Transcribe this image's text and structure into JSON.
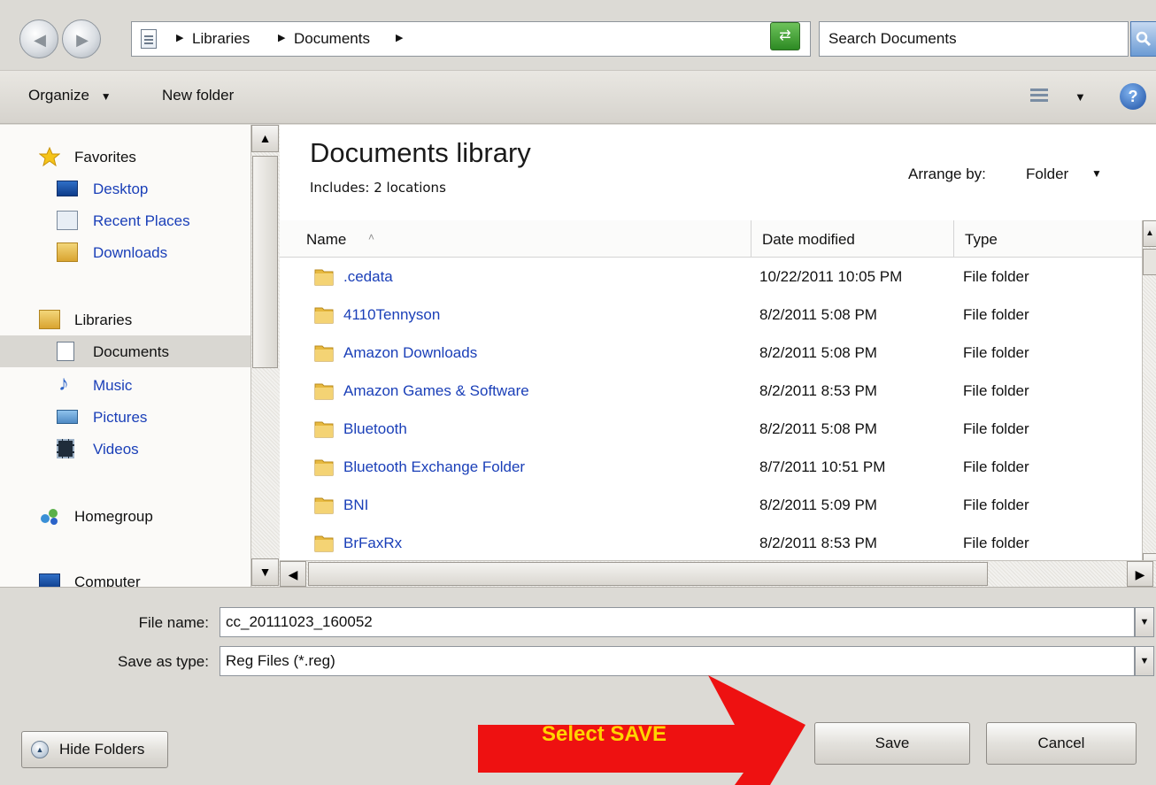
{
  "address_bar": {
    "crumbs": [
      "Libraries",
      "Documents"
    ],
    "search_placeholder": "Search Documents"
  },
  "toolbar": {
    "organize": "Organize",
    "new_folder": "New folder"
  },
  "nav": {
    "favorites": "Favorites",
    "desktop": "Desktop",
    "recent_places": "Recent Places",
    "downloads": "Downloads",
    "libraries": "Libraries",
    "documents": "Documents",
    "music": "Music",
    "pictures": "Pictures",
    "videos": "Videos",
    "homegroup": "Homegroup",
    "computer": "Computer"
  },
  "library": {
    "title": "Documents library",
    "subtitle": "Includes:  2 locations",
    "arrange_label": "Arrange by:",
    "arrange_value": "Folder"
  },
  "columns": {
    "name": "Name",
    "date": "Date modified",
    "type": "Type"
  },
  "files": [
    {
      "name": ".cedata",
      "date": "10/22/2011 10:05 PM",
      "type": "File folder"
    },
    {
      "name": "4110Tennyson",
      "date": "8/2/2011 5:08 PM",
      "type": "File folder"
    },
    {
      "name": "Amazon Downloads",
      "date": "8/2/2011 5:08 PM",
      "type": "File folder"
    },
    {
      "name": "Amazon Games & Software",
      "date": "8/2/2011 8:53 PM",
      "type": "File folder"
    },
    {
      "name": "Bluetooth",
      "date": "8/2/2011 5:08 PM",
      "type": "File folder"
    },
    {
      "name": "Bluetooth Exchange Folder",
      "date": "8/7/2011 10:51 PM",
      "type": "File folder"
    },
    {
      "name": "BNI",
      "date": "8/2/2011 5:09 PM",
      "type": "File folder"
    },
    {
      "name": "BrFaxRx",
      "date": "8/2/2011 8:53 PM",
      "type": "File folder"
    }
  ],
  "form": {
    "filename_label": "File name:",
    "filename_value": "cc_20111023_160052",
    "filetype_label": "Save as type:",
    "filetype_value": "Reg Files (*.reg)"
  },
  "buttons": {
    "hide_folders": "Hide Folders",
    "save": "Save",
    "cancel": "Cancel"
  },
  "callout": {
    "text": "Select SAVE",
    "color": "#ee1111",
    "text_color": "#ffd400"
  }
}
